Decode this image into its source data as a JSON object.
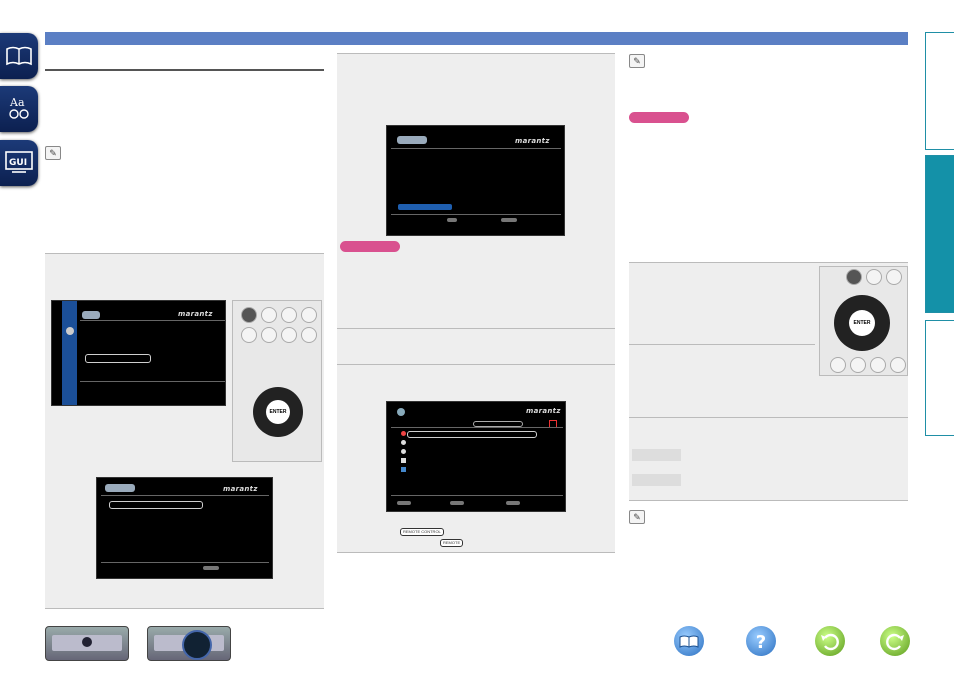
{
  "brand": "marantz",
  "enter_label": "ENTER",
  "remote_labels": {
    "remote_control": "REMOTE CONTROL",
    "remote": "REMOTE"
  },
  "icons": {
    "left_tabs": [
      "book-icon",
      "glossary-icon",
      "gui-icon"
    ],
    "bottom_nav": [
      "contents-book-icon",
      "help-icon",
      "back-icon",
      "forward-icon"
    ]
  },
  "colors": {
    "header_bar": "#5b7fc4",
    "side_tab_active": "#1491a8",
    "badge": "#d9518f",
    "selection": "#1f5fb0"
  }
}
